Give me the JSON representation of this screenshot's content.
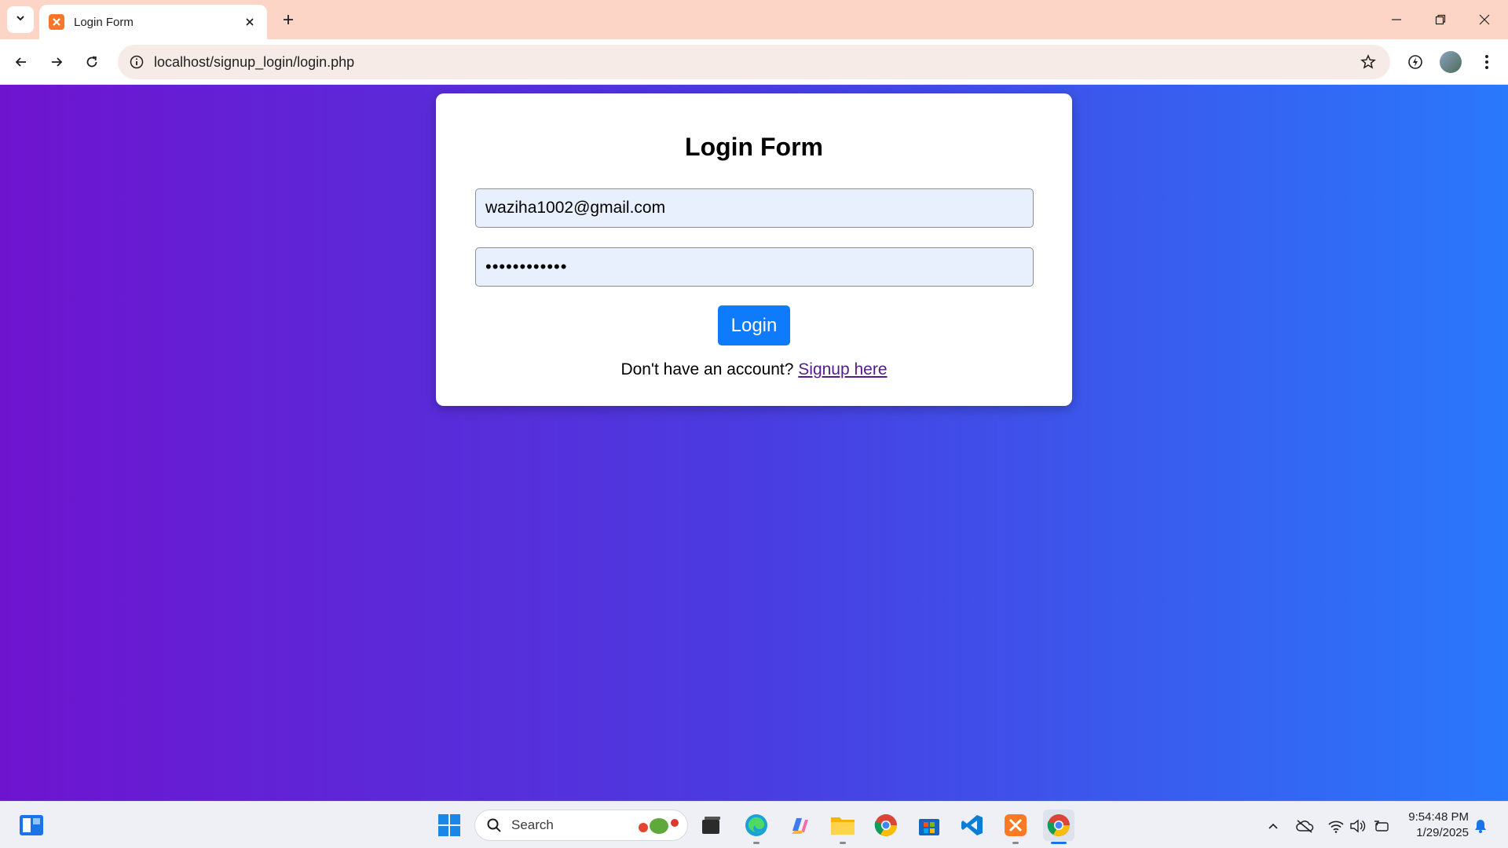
{
  "browser": {
    "tab_title": "Login Form",
    "url": "localhost/signup_login/login.php"
  },
  "form": {
    "title": "Login Form",
    "email_value": "waziha1002@gmail.com",
    "password_value": "••••••••••••",
    "login_label": "Login",
    "signup_prompt": "Don't have an account?",
    "signup_link": "Signup here"
  },
  "taskbar": {
    "search_label": "Search",
    "time": "9:54:48 PM",
    "date": "1/29/2025"
  },
  "colors": {
    "gradient_start": "#6e14cf",
    "gradient_end": "#2a78fb",
    "button": "#0d7bfb",
    "link": "#551a8b",
    "tab_strip": "#fdd5c6"
  }
}
